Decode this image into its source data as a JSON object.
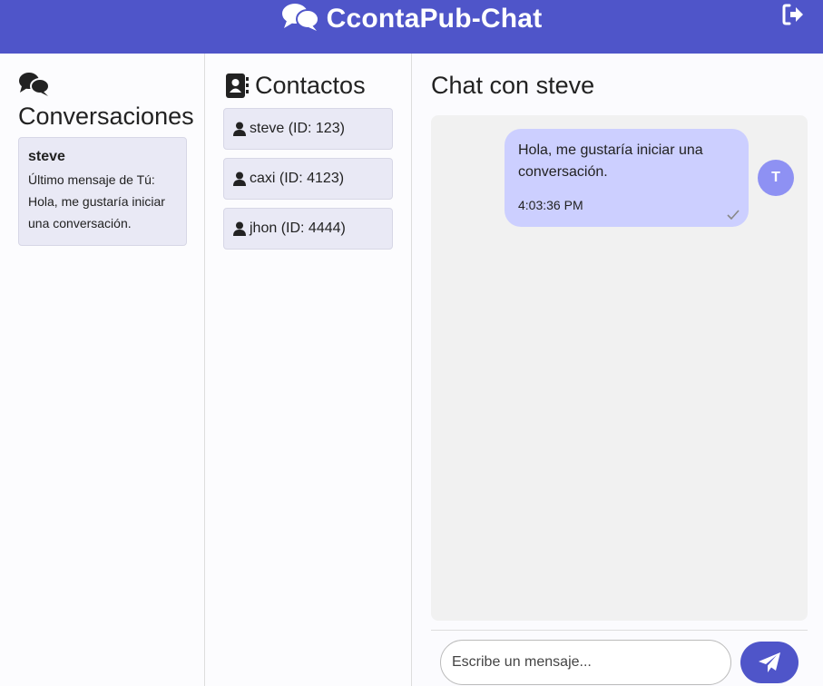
{
  "header": {
    "title": "CcontaPub-Chat",
    "icon": "comments-icon",
    "logout_icon": "sign-out-icon",
    "color": "#4f55c9"
  },
  "conversations": {
    "heading": "Conversaciones",
    "items": [
      {
        "name": "steve",
        "preview": "Último mensaje de Tú: Hola, me gustaría iniciar una conversación."
      }
    ]
  },
  "contacts": {
    "heading": "Contactos",
    "items": [
      {
        "label": "steve (ID: 123)"
      },
      {
        "label": "caxi (ID: 4123)"
      },
      {
        "label": "jhon (ID: 4444)"
      }
    ]
  },
  "chat": {
    "title": "Chat con steve",
    "messages": [
      {
        "text": "Hola, me gustaría iniciar una conversación.",
        "time": "4:03:36 PM",
        "avatar": "T",
        "status": "sent"
      }
    ],
    "input_placeholder": "Escribe un mensaje...",
    "send_icon": "paper-plane-icon"
  }
}
